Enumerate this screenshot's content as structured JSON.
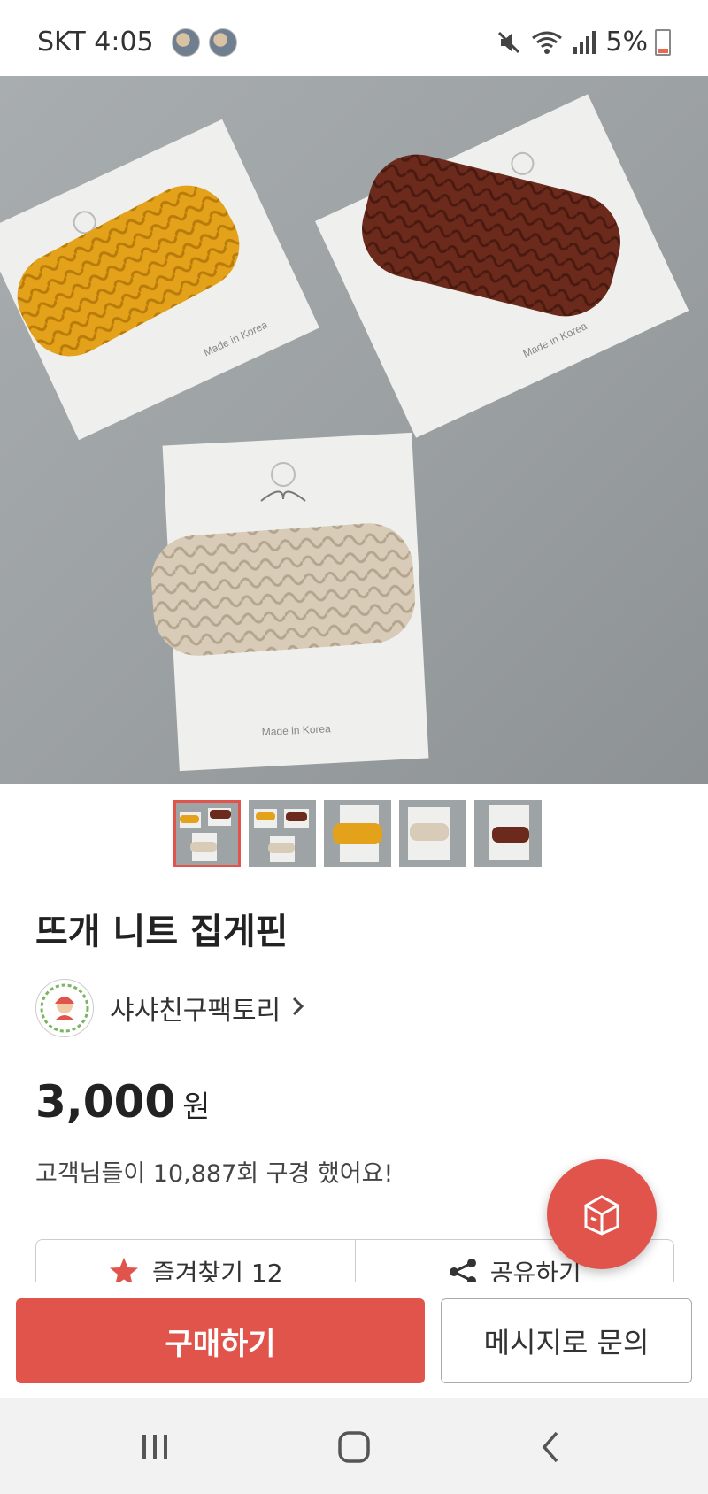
{
  "status_bar": {
    "carrier_time": "SKT 4:05",
    "battery_percent": "5%"
  },
  "product": {
    "title": "뜨개 니트 집게핀",
    "price": "3,000",
    "price_unit": "원",
    "views_text": "고객님들이 10,887회 구경 했어요!",
    "image_labels": [
      "Made in Korea",
      "Made in Korea",
      "Made in Korea"
    ],
    "thumbnail_count": 5,
    "selected_thumbnail": 1
  },
  "seller": {
    "name": "샤샤친구팩토리"
  },
  "actions": {
    "favorite_label": "즐겨찾기  12",
    "share_label": "공유하기"
  },
  "bottom": {
    "buy_label": "구매하기",
    "message_label": "메시지로 문의"
  },
  "colors": {
    "accent": "#e1544b",
    "mustard": "#e3a21a",
    "brown": "#6b2a1c",
    "beige": "#d8cbb8"
  },
  "icons": {
    "fab": "box-icon",
    "favorite": "star-icon",
    "share": "share-icon",
    "nav_recents": "recents-icon",
    "nav_home": "home-icon",
    "nav_back": "back-icon"
  }
}
